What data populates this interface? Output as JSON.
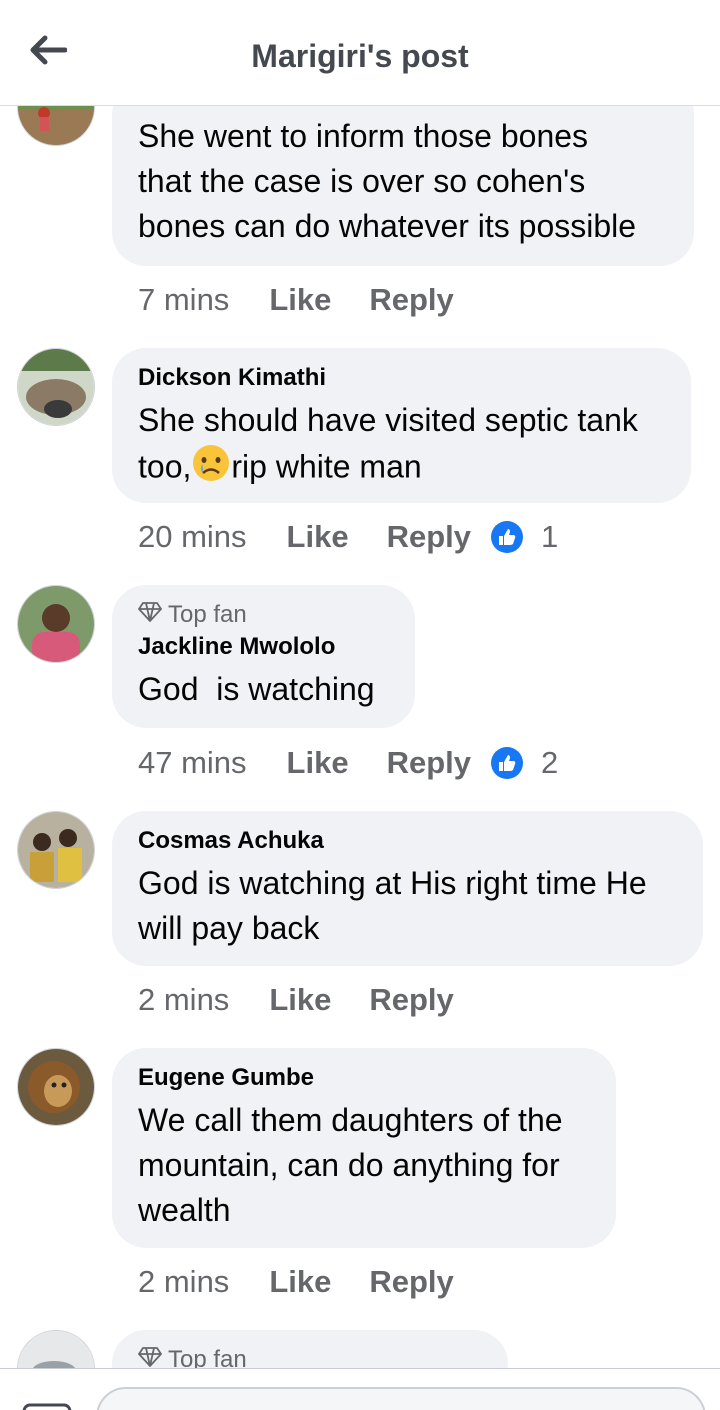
{
  "header": {
    "title": "Marigiri's post"
  },
  "icons": {
    "back": "arrow-left-icon",
    "top_fan": "diamond-icon",
    "like_reaction": "thumbs-up-icon",
    "emoji": "sad-tear-emoji"
  },
  "colors": {
    "accent": "#1877f2",
    "bubble": "#f0f2f5",
    "meta": "#65676b"
  },
  "actions": {
    "like": "Like",
    "reply": "Reply"
  },
  "comments": [
    {
      "author": "",
      "text_lines": [
        "She went to inform those bones",
        "that the case is over so cohen's",
        "bones can do whatever its possible"
      ],
      "time": "7 mins"
    },
    {
      "author": "Dickson Kimathi",
      "text_line1": "She should have visited septic tank",
      "text_before_emoji": "too,",
      "text_after_emoji": "rip white man",
      "time": "20 mins",
      "reactions": "1"
    },
    {
      "badge": "Top fan",
      "author": "Jackline Mwololo",
      "text": "God  is watching",
      "time": "47 mins",
      "reactions": "2"
    },
    {
      "author": "Cosmas Achuka",
      "text_lines": [
        "God is watching at His right time He",
        "will pay back"
      ],
      "time": "2 mins"
    },
    {
      "author": "Eugene Gumbe",
      "text_lines": [
        "We call them daughters of the",
        "mountain, can do anything for",
        "wealth"
      ],
      "time": "2 mins"
    },
    {
      "badge": "Top fan"
    }
  ]
}
